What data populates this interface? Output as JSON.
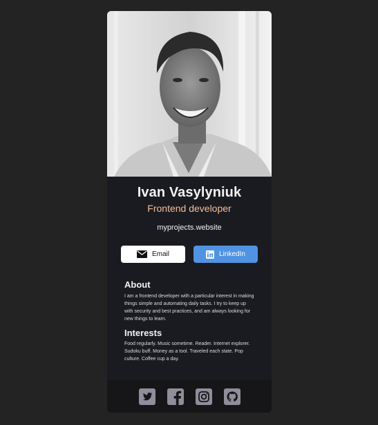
{
  "profile": {
    "name": "Ivan Vasylyniuk",
    "role": "Frontend developer",
    "website": "myprojects.website"
  },
  "buttons": {
    "email_label": "Email",
    "linkedin_label": "LinkedIn"
  },
  "about": {
    "title": "About",
    "text": "I am a frontend developer with a particular interest in making things simple and automating daily tasks. I try to keep up with security and best practices, and am always looking for new things to learn."
  },
  "interests": {
    "title": "Interests",
    "text": "Food regularly. Music sometime. Reader. Internet explorer. Sudoku buff. Money as a tool. Traveled each state. Pop culture. Coffee cup a day."
  },
  "colors": {
    "page_background": "#232323",
    "card_background": "#1a1b21",
    "footer_background": "#161619",
    "role_accent": "#f3bf99",
    "linkedin_button": "#5093e2",
    "social_icon": "#918e9b"
  },
  "footer": {
    "icons": [
      "twitter-icon",
      "facebook-icon",
      "instagram-icon",
      "github-icon"
    ]
  }
}
